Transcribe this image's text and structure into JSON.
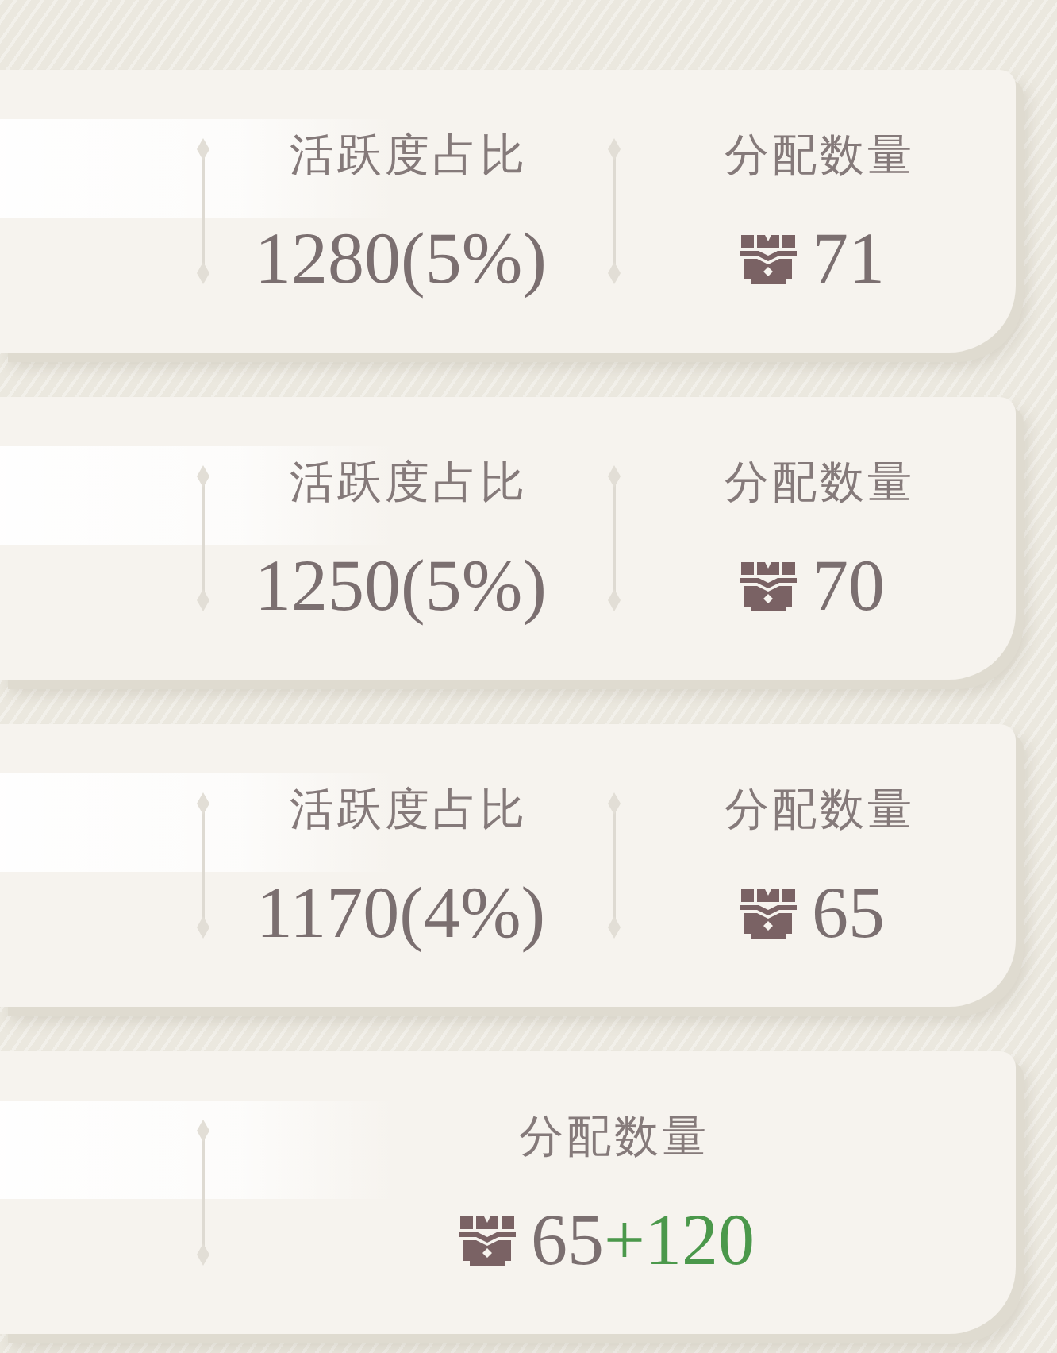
{
  "cards": [
    {
      "columns": [
        {
          "kind": "ratio",
          "label": "活跃度占比",
          "value": "1280(5%)"
        },
        {
          "kind": "allocation",
          "label": "分配数量",
          "value": "71"
        }
      ]
    },
    {
      "columns": [
        {
          "kind": "ratio",
          "label": "活跃度占比",
          "value": "1250(5%)"
        },
        {
          "kind": "allocation",
          "label": "分配数量",
          "value": "70"
        }
      ]
    },
    {
      "columns": [
        {
          "kind": "ratio",
          "label": "活跃度占比",
          "value": "1170(4%)"
        },
        {
          "kind": "allocation",
          "label": "分配数量",
          "value": "65"
        }
      ]
    },
    {
      "columns": [
        {
          "kind": "allocation",
          "label": "分配数量",
          "value": "65",
          "bonus": "+120"
        }
      ]
    }
  ]
}
